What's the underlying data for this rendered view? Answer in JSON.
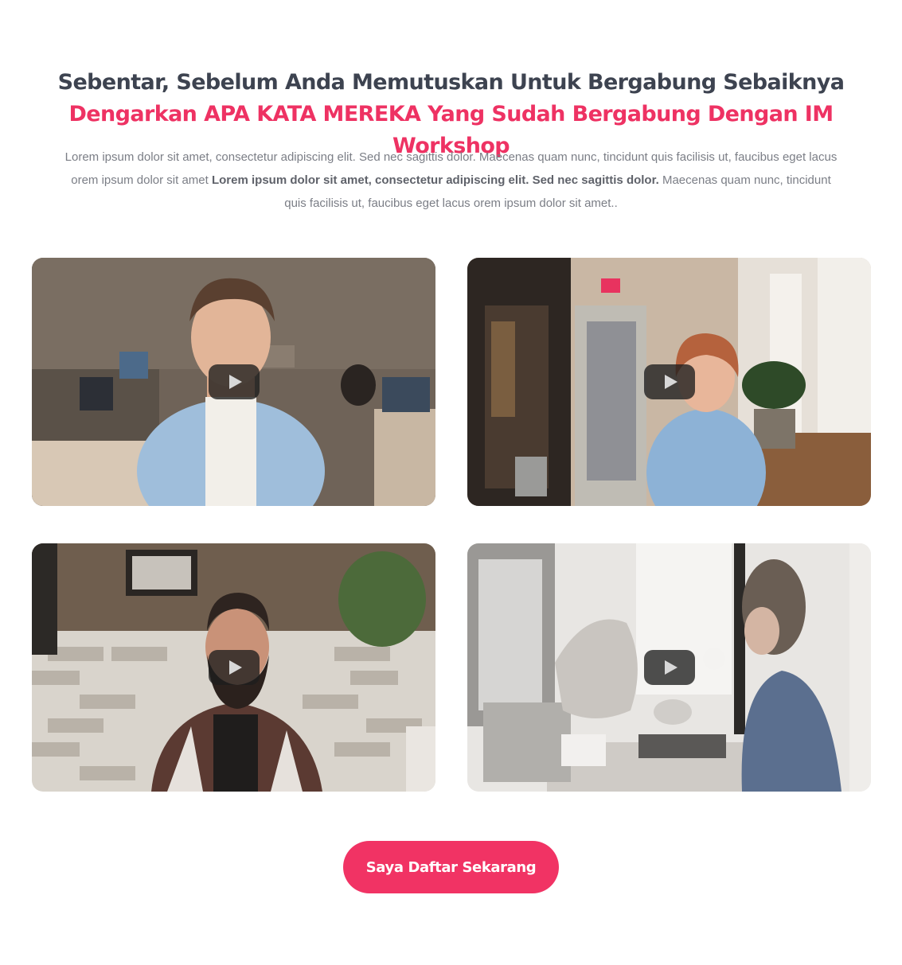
{
  "heading": {
    "dark": "Sebentar, Sebelum Anda Memutuskan Untuk Bergabung Sebaiknya",
    "accent": "Dengarkan APA KATA MEREKA Yang Sudah Bergabung Dengan IM Workshop"
  },
  "intro": {
    "part1": "Lorem ipsum dolor sit amet, consectetur adipiscing elit. Sed nec sagittis dolor. Maecenas quam nunc, tincidunt quis facilisis ut, faucibus eget lacus orem ipsum dolor sit amet",
    "bold": "Lorem ipsum dolor sit amet, consectetur adipiscing elit. Sed nec sagittis dolor.",
    "part2": "Maecenas quam nunc, tincidunt quis facilisis ut, faucibus eget lacus orem ipsum dolor sit amet.."
  },
  "videos": [
    {
      "icon": "play-icon",
      "scene": "man in denim shirt in office"
    },
    {
      "icon": "play-icon",
      "scene": "smiling woman at cafe table"
    },
    {
      "icon": "play-icon",
      "scene": "man in flannel shirt by brick wall"
    },
    {
      "icon": "play-icon",
      "scene": "woman with laptop and coffee"
    }
  ],
  "cta": {
    "label": "Saya Daftar Sekarang"
  },
  "colors": {
    "accent": "#ee3263",
    "heading": "#3d4350",
    "body_text": "#7b7e86",
    "button": "#f13364"
  }
}
